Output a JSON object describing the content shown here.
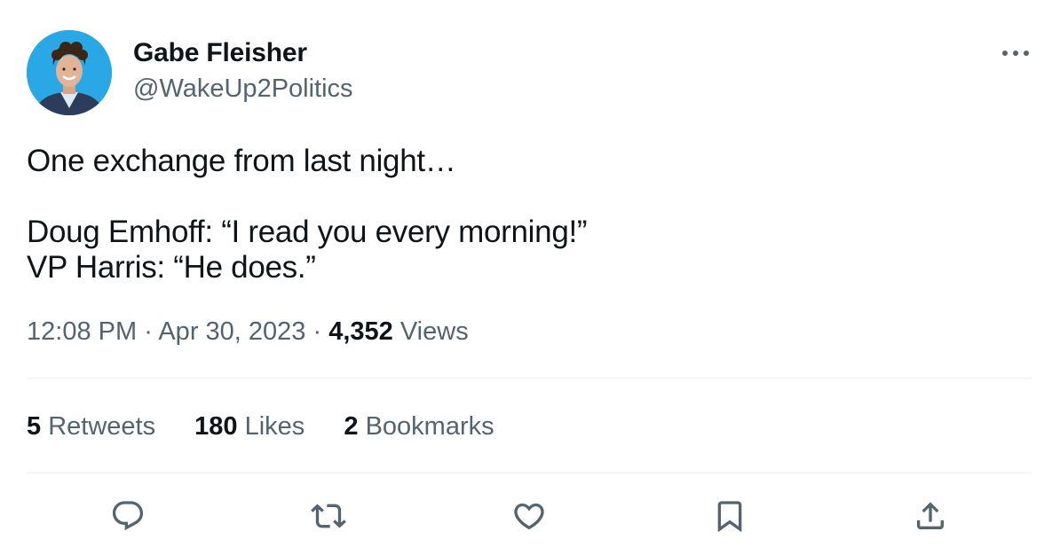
{
  "author": {
    "name": "Gabe Fleisher",
    "handle": "@WakeUp2Politics",
    "avatar_icon": "profile-photo"
  },
  "menu": {
    "more_icon": "more-horizontal-icon"
  },
  "tweet": {
    "lines": [
      "One exchange from last night…",
      "Doug Emhoff: “I read you every morning!”",
      "VP Harris: “He does.”"
    ]
  },
  "meta": {
    "time": "12:08 PM",
    "separator": "·",
    "date": "Apr 30, 2023",
    "views_count": "4,352",
    "views_label": "Views"
  },
  "stats": {
    "retweets_count": "5",
    "retweets_label": "Retweets",
    "likes_count": "180",
    "likes_label": "Likes",
    "bookmarks_count": "2",
    "bookmarks_label": "Bookmarks"
  },
  "actions": [
    {
      "icon": "reply-icon"
    },
    {
      "icon": "retweet-icon"
    },
    {
      "icon": "like-icon"
    },
    {
      "icon": "bookmark-icon"
    },
    {
      "icon": "share-icon"
    }
  ],
  "colors": {
    "primary_text": "#0f1419",
    "secondary_text": "#536471",
    "divider": "#eff3f4",
    "avatar_background": "#2aa8e6"
  }
}
